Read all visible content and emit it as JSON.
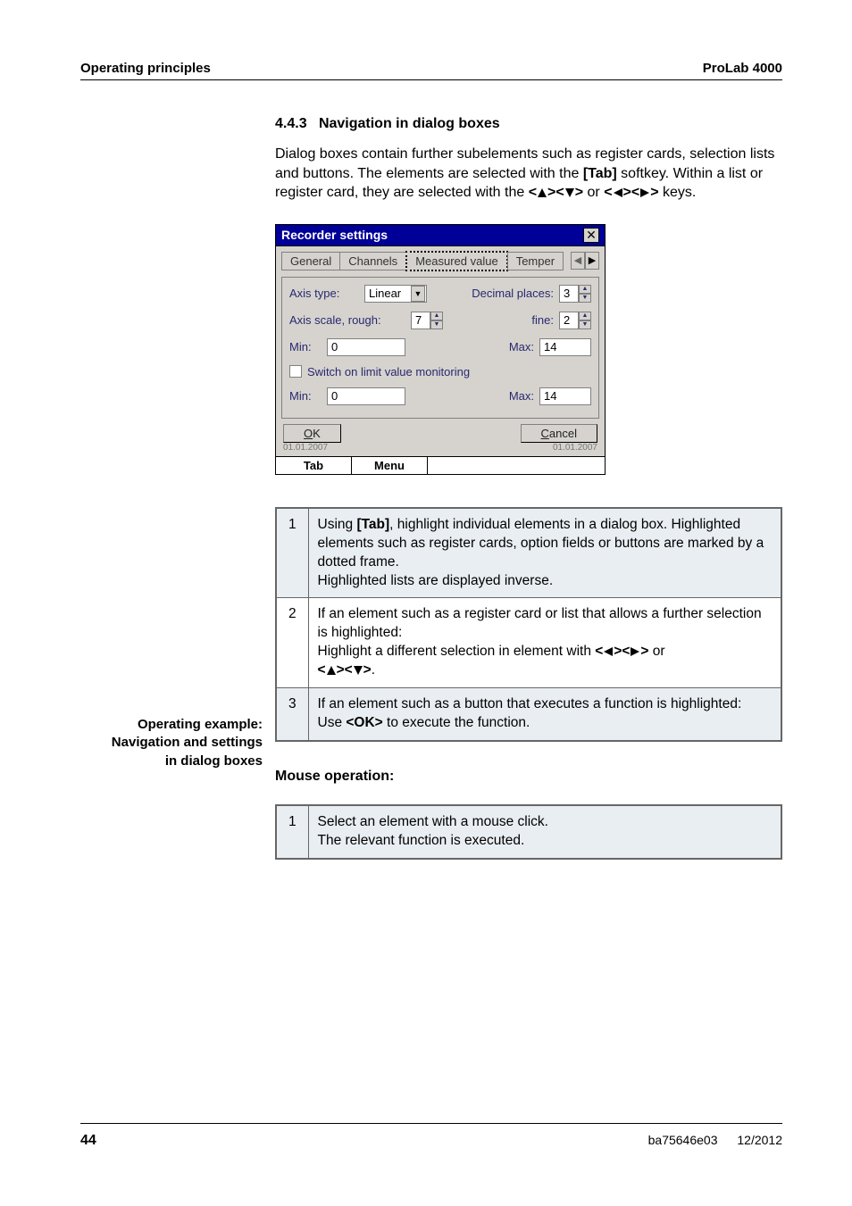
{
  "header": {
    "left": "Operating principles",
    "right": "ProLab 4000"
  },
  "section": {
    "number": "4.4.3",
    "title": "Navigation in dialog boxes",
    "paragraph_parts": {
      "p1": "Dialog boxes contain further subelements such as register cards, selection lists and buttons. The elements are selected with the ",
      "tab": "[Tab]",
      "p2": " softkey. Within a list or register card, they are selected with the ",
      "keys1a": "<",
      "keys1b": "><",
      "keys1c": ">",
      "or": " or ",
      "keys2a": "<",
      "keys2b": "><",
      "keys2c": ">",
      "p3": " keys."
    }
  },
  "dialog": {
    "title": "Recorder settings",
    "tabs": {
      "t1": "General",
      "t2": "Channels",
      "t3": "Measured value",
      "t4": "Temper"
    },
    "axis_type_label": "Axis type:",
    "axis_type_value": "Linear",
    "decimal_label": "Decimal places:",
    "decimal_value": "3",
    "axis_scale_label": "Axis scale, rough:",
    "axis_scale_value": "7",
    "fine_label": "fine:",
    "fine_value": "2",
    "min1_label": "Min:",
    "min1_value": "0",
    "max1_label": "Max:",
    "max1_value": "14",
    "switch_label": "Switch on limit value monitoring",
    "min2_label": "Min:",
    "min2_value": "0",
    "max2_label": "Max:",
    "max2_value": "14",
    "ok_u": "O",
    "ok_rest": "K",
    "cancel_u": "C",
    "cancel_rest": "ancel",
    "dt_left": "01.01.2007",
    "dt_right": "01.01.2007",
    "softkeys": {
      "tab": "Tab",
      "menu": "Menu"
    }
  },
  "side_label": {
    "l1": "Operating example:",
    "l2": "Navigation and settings",
    "l3": "in dialog boxes"
  },
  "steps1": {
    "r1": {
      "num": "1",
      "t1": "Using ",
      "tab": "[Tab]",
      "t2": ", highlight individual elements in a dialog box. Highlighted elements such as register cards, option fields or buttons are marked by a dotted frame.",
      "t3": "Highlighted lists are displayed inverse."
    },
    "r2": {
      "num": "2",
      "t1": "If an element such as a register card or list that allows a further selection is highlighted:",
      "t2a": "Highlight a different selection in element with ",
      "or": " or ",
      "period": "."
    },
    "r3": {
      "num": "3",
      "t1": "If an element such as a button that executes a function is highlighted:",
      "t2a": "Use ",
      "ok": "<OK>",
      "t2b": " to execute the function."
    }
  },
  "mouse_heading": "Mouse operation:",
  "steps2": {
    "r1": {
      "num": "1",
      "t1": "Select an element with a mouse click.",
      "t2": "The relevant function is executed."
    }
  },
  "footer": {
    "page": "44",
    "code": "ba75646e03",
    "date": "12/2012"
  }
}
